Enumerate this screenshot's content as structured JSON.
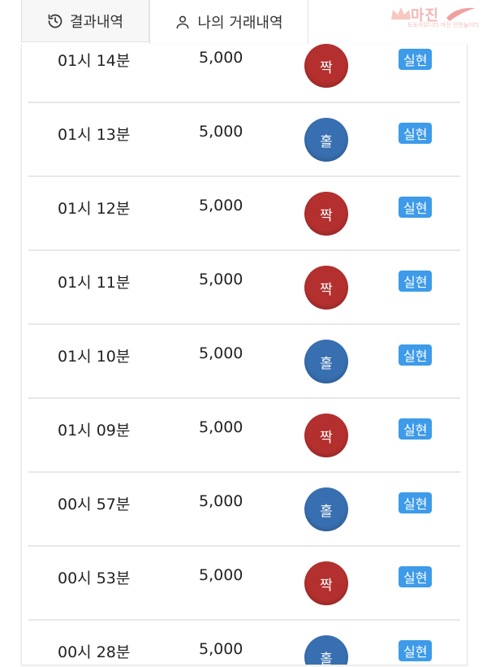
{
  "tabs": {
    "results_label": "결과내역",
    "mine_label": "나의 거래내역"
  },
  "logo": {
    "text": "마진",
    "sub": "토토커뮤니티 마진 안전놀이터"
  },
  "colors": {
    "odd": "#386fb0",
    "even": "#b3302e",
    "badge": "#3d9be9"
  },
  "rows": [
    {
      "time": "01시 14분",
      "amount": "5,000",
      "result": "짝",
      "type": "even",
      "status": "실현"
    },
    {
      "time": "01시 13분",
      "amount": "5,000",
      "result": "홀",
      "type": "odd",
      "status": "실현"
    },
    {
      "time": "01시 12분",
      "amount": "5,000",
      "result": "짝",
      "type": "even",
      "status": "실현"
    },
    {
      "time": "01시 11분",
      "amount": "5,000",
      "result": "짝",
      "type": "even",
      "status": "실현"
    },
    {
      "time": "01시 10분",
      "amount": "5,000",
      "result": "홀",
      "type": "odd",
      "status": "실현"
    },
    {
      "time": "01시 09분",
      "amount": "5,000",
      "result": "짝",
      "type": "even",
      "status": "실현"
    },
    {
      "time": "00시 57분",
      "amount": "5,000",
      "result": "홀",
      "type": "odd",
      "status": "실현"
    },
    {
      "time": "00시 53분",
      "amount": "5,000",
      "result": "짝",
      "type": "even",
      "status": "실현"
    },
    {
      "time": "00시 28분",
      "amount": "5,000",
      "result": "홀",
      "type": "odd",
      "status": "실현"
    }
  ]
}
